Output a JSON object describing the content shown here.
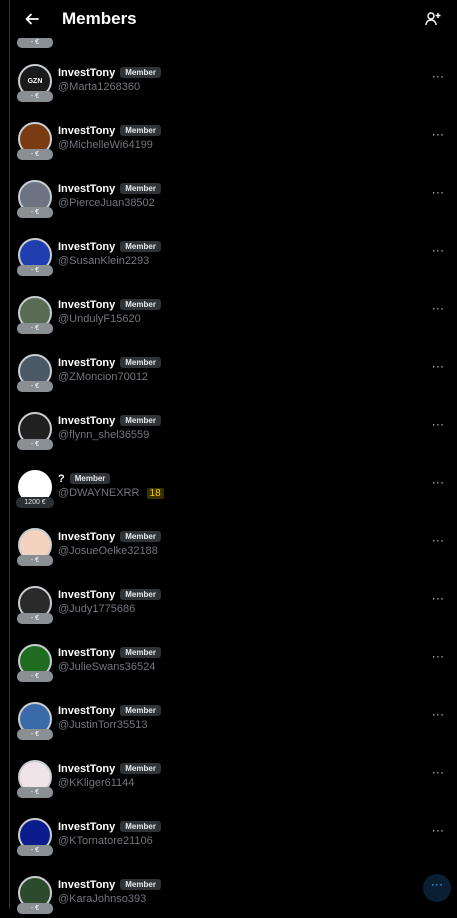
{
  "header": {
    "title": "Members",
    "back_icon": "arrow-left-icon",
    "add_icon": "person-add-icon"
  },
  "top_partial_pill": "- €",
  "members": [
    {
      "name": "InvestTony",
      "badge": "Member",
      "handle": "@Marta1268360",
      "pill": "- €",
      "avatar_color": "#1a1a1a",
      "avatar_text": "GZN"
    },
    {
      "name": "InvestTony",
      "badge": "Member",
      "handle": "@MichelleWi64199",
      "pill": "- €",
      "avatar_color": "#7a3b12"
    },
    {
      "name": "InvestTony",
      "badge": "Member",
      "handle": "@PierceJuan38502",
      "pill": "- €",
      "avatar_color": "#6b7480"
    },
    {
      "name": "InvestTony",
      "badge": "Member",
      "handle": "@SusanKlein2293",
      "pill": "- €",
      "avatar_color": "#1f3fb0"
    },
    {
      "name": "InvestTony",
      "badge": "Member",
      "handle": "@UndulyF15620",
      "pill": "- €",
      "avatar_color": "#5a6b55"
    },
    {
      "name": "InvestTony",
      "badge": "Member",
      "handle": "@ZMoncion70012",
      "pill": "- €",
      "avatar_color": "#4b5866"
    },
    {
      "name": "InvestTony",
      "badge": "Member",
      "handle": "@flynn_shel36559",
      "pill": "- €",
      "avatar_color": "#202020"
    },
    {
      "name": "?",
      "badge": "Member",
      "handle": "@DWAYNEXRR",
      "count": "18",
      "pill": "1200 €",
      "avatar_color": "#ffffff",
      "pill_dark": true
    },
    {
      "name": "InvestTony",
      "badge": "Member",
      "handle": "@JosueOelke32188",
      "pill": "- €",
      "avatar_color": "#f3d2c0"
    },
    {
      "name": "InvestTony",
      "badge": "Member",
      "handle": "@Judy1775686",
      "pill": "- €",
      "avatar_color": "#2a2a2a"
    },
    {
      "name": "InvestTony",
      "badge": "Member",
      "handle": "@JulieSwans36524",
      "pill": "- €",
      "avatar_color": "#1f6b1f"
    },
    {
      "name": "InvestTony",
      "badge": "Member",
      "handle": "@JustinTorr35513",
      "pill": "- €",
      "avatar_color": "#3a6ba8"
    },
    {
      "name": "InvestTony",
      "badge": "Member",
      "handle": "@KKliger61144",
      "pill": "- €",
      "avatar_color": "#f0e4e8"
    },
    {
      "name": "InvestTony",
      "badge": "Member",
      "handle": "@KTornatore21106",
      "pill": "- €",
      "avatar_color": "#0b1c8c"
    },
    {
      "name": "InvestTony",
      "badge": "Member",
      "handle": "@KaraJohnso393",
      "pill": "- €",
      "avatar_color": "#2c4a2c",
      "more_active": true
    }
  ],
  "more_icon": "more-horizontal-icon"
}
